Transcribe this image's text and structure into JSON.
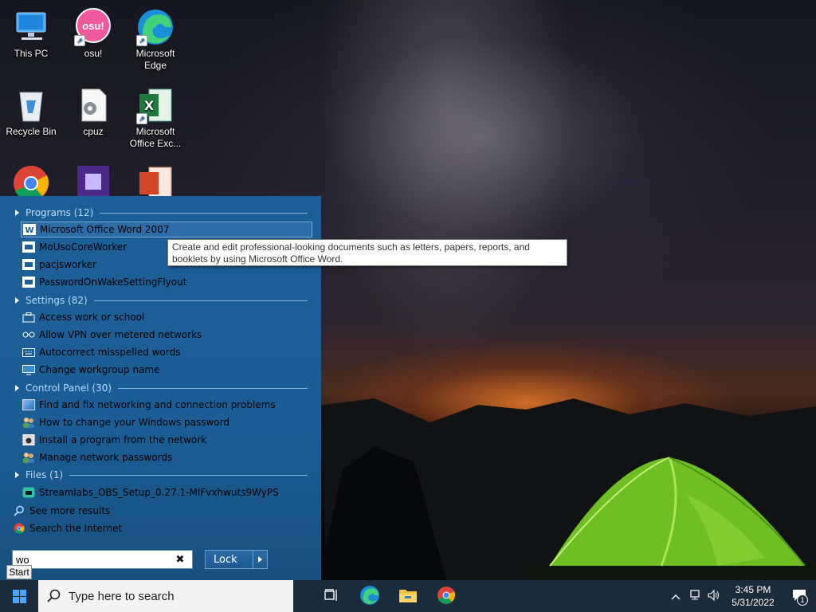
{
  "desktop": {
    "icons": [
      {
        "label": "This PC",
        "icon": "this-pc-icon"
      },
      {
        "label": "osu!",
        "badge": "osu!",
        "icon": "osu-icon"
      },
      {
        "label": "Microsoft Edge",
        "icon": "edge-icon"
      },
      {
        "label": "Recycle Bin",
        "icon": "recycle-bin-icon"
      },
      {
        "label": "cpuz",
        "icon": "cpuz-icon"
      },
      {
        "label": "Microsoft Office Exc...",
        "icon": "excel-icon"
      }
    ]
  },
  "start_menu": {
    "groups": [
      {
        "header": "Programs (12)",
        "items": [
          {
            "label": "Microsoft Office Word 2007",
            "icon": "word-icon",
            "selected": true
          },
          {
            "label": "MoUsoCoreWorker",
            "icon": "application-icon"
          },
          {
            "label": "pacjsworker",
            "icon": "application-icon"
          },
          {
            "label": "PasswordOnWakeSettingFlyout",
            "icon": "application-icon"
          }
        ]
      },
      {
        "header": "Settings (82)",
        "items": [
          {
            "label": "Access work or school",
            "icon": "briefcase-icon"
          },
          {
            "label": "Allow VPN over metered networks",
            "icon": "vpn-icon"
          },
          {
            "label": "Autocorrect misspelled words",
            "icon": "keyboard-icon"
          },
          {
            "label": "Change workgroup name",
            "icon": "monitor-icon"
          }
        ]
      },
      {
        "header": "Control Panel (30)",
        "items": [
          {
            "label": "Find and fix networking and connection problems",
            "icon": "network-troubleshoot-icon"
          },
          {
            "label": "How to change your Windows password",
            "icon": "users-icon"
          },
          {
            "label": "Install a program from the network",
            "icon": "install-icon"
          },
          {
            "label": "Manage network passwords",
            "icon": "users-icon"
          }
        ]
      },
      {
        "header": "Files (1)",
        "items": [
          {
            "label": "Streamlabs_OBS_Setup_0.27.1-MIFvxhwuts9WyPS",
            "icon": "streamlabs-icon"
          }
        ]
      }
    ],
    "see_more": "See more results",
    "search_internet": "Search the Internet",
    "search_value": "wo",
    "lock_label": "Lock",
    "start_tooltip": "Start"
  },
  "tooltip": {
    "text": "Create and edit professional-looking documents such as letters, papers, reports, and booklets by using Microsoft Office Word."
  },
  "taskbar": {
    "search_placeholder": "Type here to search",
    "apps": [
      "task-view-icon",
      "edge-icon",
      "file-explorer-icon",
      "chrome-icon"
    ],
    "time": "3:45 PM",
    "date": "5/31/2022",
    "notification_count": "1"
  },
  "colors": {
    "start_menu_bg": "#1c5e96",
    "group_header": "#b7dcff",
    "taskbar_bg": "#1c2b3a",
    "win_blue": "#47a7ff"
  }
}
